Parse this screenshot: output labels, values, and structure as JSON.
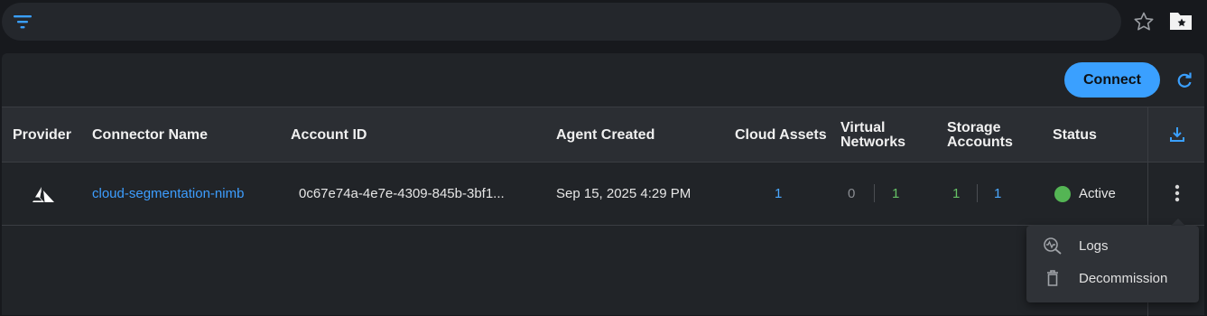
{
  "toolbar": {
    "filter_icon": "filter-icon",
    "star_icon": "star-icon",
    "folder_icon": "folder-star-icon"
  },
  "actions": {
    "connect_label": "Connect",
    "refresh_icon": "refresh-icon"
  },
  "table": {
    "headers": {
      "provider": "Provider",
      "connector_name": "Connector Name",
      "account_id": "Account ID",
      "agent_created": "Agent Created",
      "cloud_assets": "Cloud Assets",
      "virtual_networks_1": "Virtual",
      "virtual_networks_2": "Networks",
      "storage_accounts_1": "Storage",
      "storage_accounts_2": "Accounts",
      "status": "Status"
    },
    "download_icon": "download-icon",
    "rows": [
      {
        "provider_icon": "azure-icon",
        "connector_name": "cloud-segmentation-nimb",
        "account_id": "0c67e74a-4e7e-4309-845b-3bf1...",
        "agent_created": "Sep 15, 2025 4:29 PM",
        "cloud_assets": "1",
        "virtual_networks_a": "0",
        "virtual_networks_b": "1",
        "storage_accounts_a": "1",
        "storage_accounts_b": "1",
        "status": "Active"
      }
    ]
  },
  "menu": {
    "items": [
      {
        "label": "Logs",
        "icon": "logs-icon"
      },
      {
        "label": "Decommission",
        "icon": "trash-icon"
      }
    ]
  },
  "colors": {
    "accent": "#3aa0ff",
    "link": "#3d9eff",
    "active": "#54b554"
  }
}
